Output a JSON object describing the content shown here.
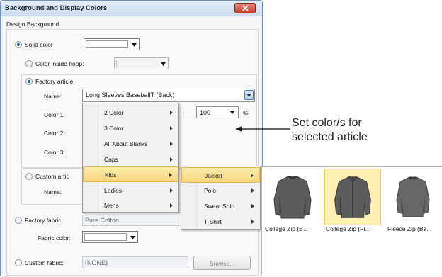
{
  "window": {
    "title": "Background and Display Colors"
  },
  "design_background": {
    "group_label": "Design Background",
    "solid_color_label": "Solid color",
    "color_inside_hoop_label": "Color inside hoop:",
    "factory_article_label": "Factory article",
    "name_label": "Name:",
    "name_value": "Long Sleeves BaseballT (Back)",
    "color1_label": "Color 1:",
    "color2_label": "Color 2:",
    "color3_label": "Color 3:",
    "colon": ":",
    "percent_value": "100",
    "percent_sign": "%",
    "custom_article_label": "Custom artic",
    "custom_name_label": "Name:",
    "factory_fabric_label": "Factory fabric:",
    "factory_fabric_value": "Pure Cotton",
    "fabric_color_label": "Fabric color:",
    "custom_fabric_label": "Custom fabric:",
    "custom_fabric_value": "(NONE)",
    "browse_label": "Browse..."
  },
  "menu1": {
    "items": [
      {
        "label": "2 Color"
      },
      {
        "label": "3 Color"
      },
      {
        "label": "All About Blanks"
      },
      {
        "label": "Caps"
      },
      {
        "label": "Kids"
      },
      {
        "label": "Ladies"
      },
      {
        "label": "Mens"
      }
    ],
    "highlighted": "Kids"
  },
  "menu2": {
    "items": [
      {
        "label": "Jacket"
      },
      {
        "label": "Polo"
      },
      {
        "label": "Sweat Shirt"
      },
      {
        "label": "T-Shirt"
      }
    ],
    "highlighted": "Jacket"
  },
  "thumbnails": [
    {
      "label": "College  Zip (B...",
      "selected": false
    },
    {
      "label": "College  Zip (Fr...",
      "selected": true
    },
    {
      "label": "Fleece Zip (Ba...",
      "selected": false
    }
  ],
  "callout": {
    "line1": "Set color/s for",
    "line2": "selected article"
  },
  "colors": {
    "highlight": "#f8d77b",
    "title_bar": "#d4e1f1",
    "close_button": "#c2402c",
    "jacket_grey": "#5c5c5c"
  }
}
